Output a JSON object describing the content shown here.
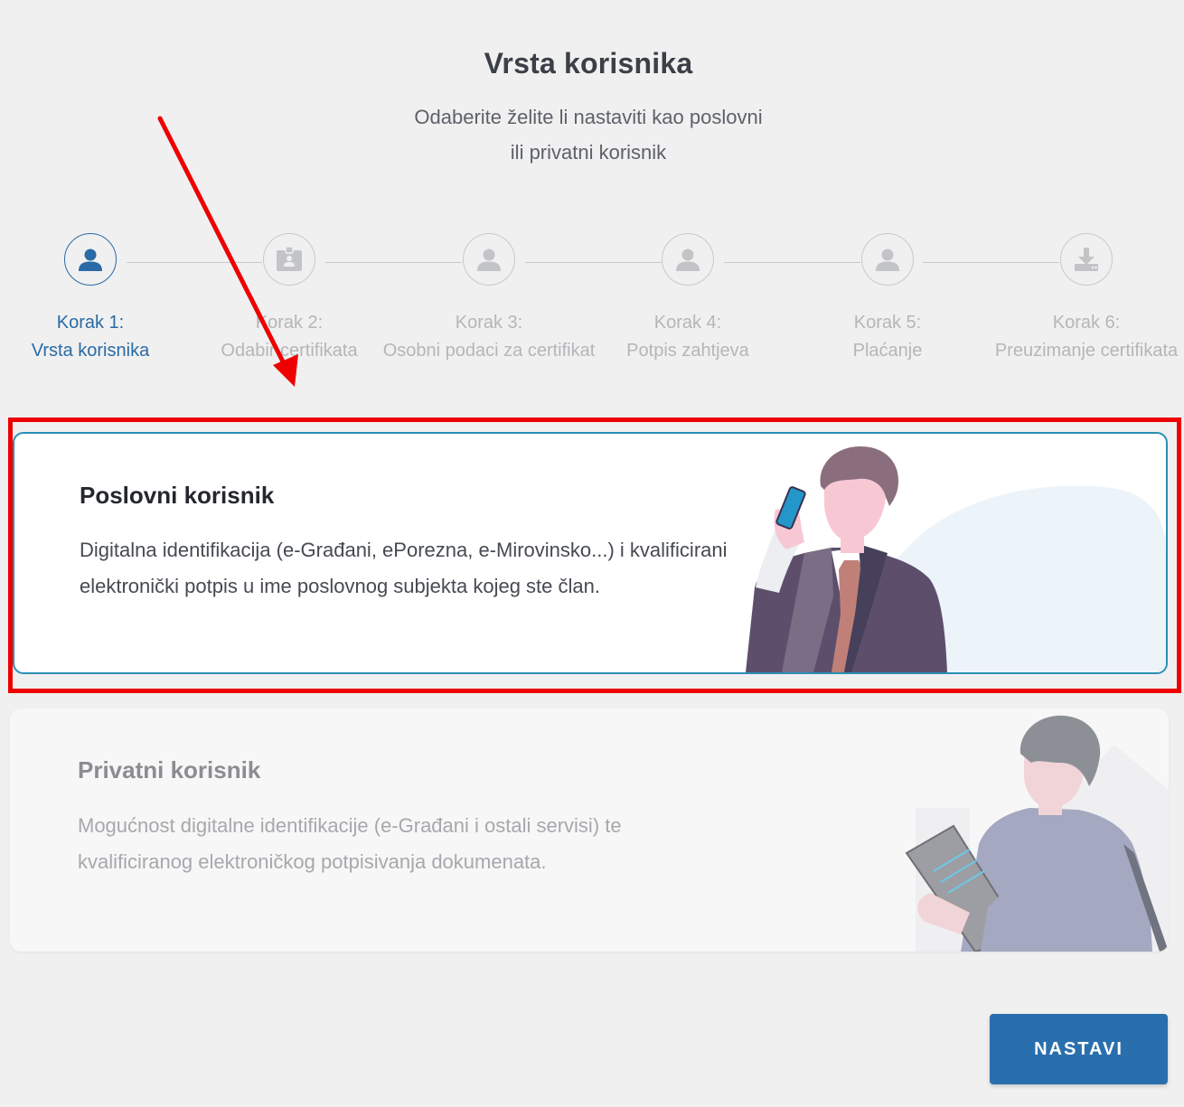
{
  "header": {
    "title": "Vrsta korisnika",
    "subtitle_line1": "Odaberite želite li nastaviti kao poslovni",
    "subtitle_line2": "ili privatni korisnik"
  },
  "steps": [
    {
      "number": "Korak 1:",
      "name": "Vrsta korisnika",
      "icon": "user-icon",
      "active": true
    },
    {
      "number": "Korak 2:",
      "name": "Odabir certifikata",
      "icon": "id-badge-icon",
      "active": false
    },
    {
      "number": "Korak 3:",
      "name": "Osobni podaci za certifikat",
      "icon": "user-icon",
      "active": false
    },
    {
      "number": "Korak 4:",
      "name": "Potpis zahtjeva",
      "icon": "user-icon",
      "active": false
    },
    {
      "number": "Korak 5:",
      "name": "Plaćanje",
      "icon": "user-icon",
      "active": false
    },
    {
      "number": "Korak 6:",
      "name": "Preuzimanje certifikata",
      "icon": "download-icon",
      "active": false
    }
  ],
  "options": {
    "business": {
      "title": "Poslovni korisnik",
      "description": "Digitalna identifikacija (e-Građani, ePorezna, e-Mirovinsko...) i kvalificirani elektronički potpis u ime poslovnog subjekta kojeg ste član.",
      "selected": true
    },
    "private": {
      "title": "Privatni korisnik",
      "description": "Mogućnost digitalne identifikacije (e-Građani i ostali servisi) te kvalificiranog elektroničkog potpisivanja dokumenata.",
      "selected": false
    }
  },
  "actions": {
    "continue_label": "NASTAVI"
  },
  "colors": {
    "accent": "#2a6aa6",
    "selected_border": "#2a8fb5",
    "annotation": "#ee0000",
    "inactive": "#b4b6b9"
  }
}
